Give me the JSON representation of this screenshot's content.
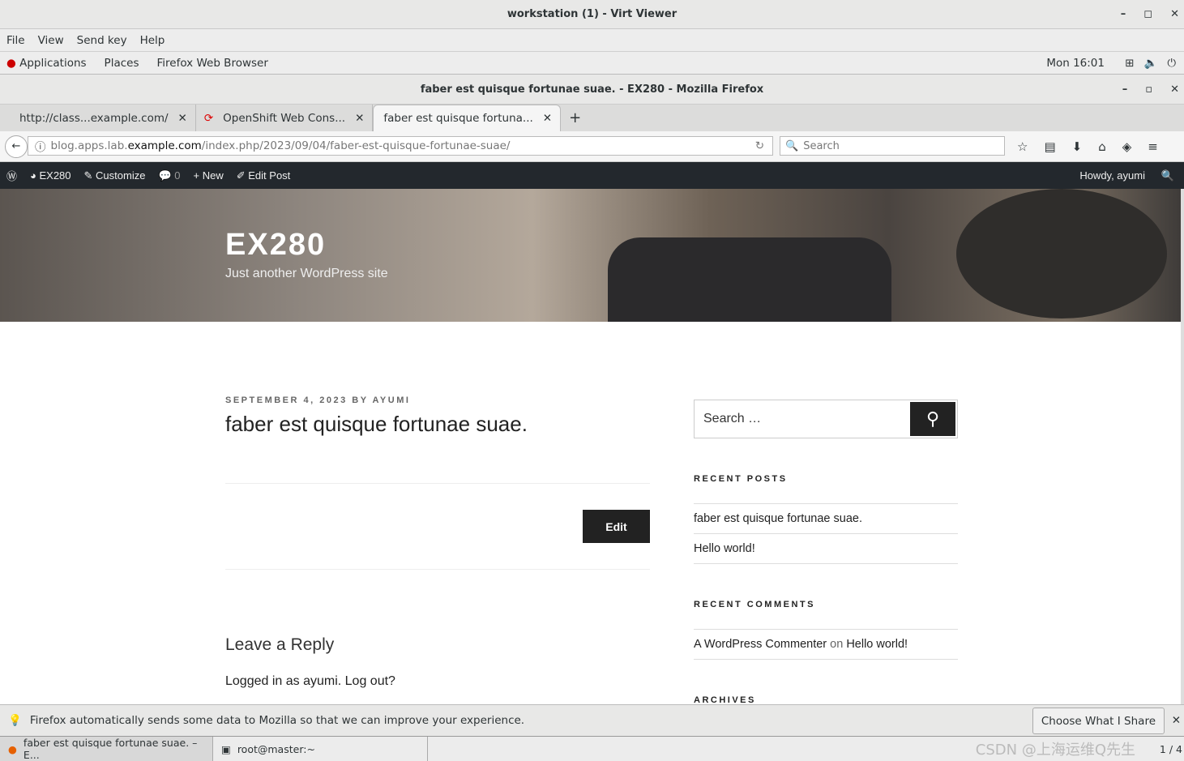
{
  "viewer": {
    "title": "workstation (1) - Virt Viewer",
    "menu": [
      "File",
      "View",
      "Send key",
      "Help"
    ]
  },
  "panel": {
    "items": [
      "Applications",
      "Places",
      "Firefox Web Browser"
    ],
    "clock": "Mon 16:01"
  },
  "firefox": {
    "title": "faber est quisque fortunae suae. - EX280 - Mozilla Firefox",
    "tabs": [
      {
        "label": "http://class...example.com/"
      },
      {
        "label": "OpenShift Web Cons..."
      },
      {
        "label": "faber est quisque fortuna..."
      }
    ],
    "url": {
      "pre": "blog.apps.lab.",
      "domain": "example.com",
      "post": "/index.php/2023/09/04/faber-est-quisque-fortunae-suae/"
    },
    "search_placeholder": "Search"
  },
  "adminbar": {
    "site": "EX280",
    "customize": "Customize",
    "comments": "0",
    "new": "New",
    "edit": "Edit Post",
    "howdy": "Howdy, ayumi"
  },
  "site": {
    "title": "EX280",
    "tagline": "Just another WordPress site"
  },
  "post": {
    "meta": "September 4, 2023 by ayumi",
    "title": "faber est quisque fortunae suae.",
    "edit": "Edit",
    "reply_title": "Leave a Reply",
    "logged_in": "Logged in as ayumi. Log out?"
  },
  "sidebar": {
    "search_placeholder": "Search …",
    "recent_posts_title": "Recent Posts",
    "recent_posts": [
      "faber est quisque fortunae suae.",
      "Hello world!"
    ],
    "recent_comments_title": "Recent Comments",
    "comment": {
      "author": "A WordPress Commenter",
      "on": "on",
      "post": "Hello world!"
    },
    "archives_title": "Archives"
  },
  "notification": {
    "text": "Firefox automatically sends some data to Mozilla so that we can improve your experience.",
    "button": "Choose What I Share"
  },
  "taskbar": {
    "items": [
      "faber est quisque fortunae suae. – E...",
      "root@master:~"
    ],
    "pager": "1 / 4"
  },
  "watermark": "CSDN @上海运维Q先生"
}
